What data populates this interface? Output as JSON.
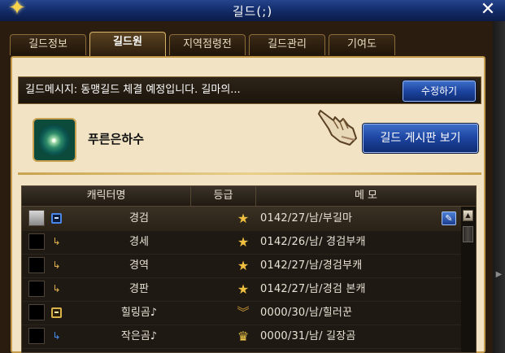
{
  "window": {
    "title": "길드(;)",
    "emblem_icon": "sparkle-emblem-icon",
    "close_label": "✕"
  },
  "tabs": [
    {
      "label": "길드정보",
      "active": false
    },
    {
      "label": "길드원",
      "active": true
    },
    {
      "label": "지역점령전",
      "active": false
    },
    {
      "label": "길드관리",
      "active": false
    },
    {
      "label": "기여도",
      "active": false
    }
  ],
  "notice": {
    "message": "길드메시지: 동맹길드 체결 예정입니다. 길마의...",
    "edit_button": "수정하기"
  },
  "guild": {
    "name": "푸른은하수",
    "board_button": "길드 게시판 보기",
    "icon": "galaxy-swirl-icon"
  },
  "table": {
    "headers": {
      "character": "캐릭터명",
      "grade": "등급",
      "memo": "메 모"
    },
    "rows": [
      {
        "name": "경검",
        "memo": "0142/27/남/부길마",
        "grade_icon": "star-icon",
        "rank_icon": "blue-box-icon",
        "selected": true,
        "has_portrait": true,
        "editable": true
      },
      {
        "name": "경세",
        "memo": "0142/26/남/ 경검부캐",
        "grade_icon": "star-icon",
        "rank_icon": "sub-arrow-icon",
        "selected": false,
        "has_portrait": false,
        "editable": false
      },
      {
        "name": "경역",
        "memo": "0142/27/남/경검부캐",
        "grade_icon": "star-icon",
        "rank_icon": "sub-arrow-icon",
        "selected": false,
        "has_portrait": false,
        "editable": false
      },
      {
        "name": "경판",
        "memo": "0142/27/남/경검 본캐",
        "grade_icon": "star-icon",
        "rank_icon": "sub-arrow-icon",
        "selected": false,
        "has_portrait": false,
        "editable": false
      },
      {
        "name": "힐링곰♪",
        "memo": "0000/30/남/힐러꾼",
        "grade_icon": "chevron-rank-icon",
        "rank_icon": "yellow-box-icon",
        "selected": false,
        "has_portrait": false,
        "editable": false
      },
      {
        "name": "작은곰♪",
        "memo": "0000/31/남/ 길장곰",
        "grade_icon": "crown-icon",
        "rank_icon": "blue-arrow-icon",
        "selected": false,
        "has_portrait": false,
        "editable": false
      }
    ]
  },
  "colors": {
    "panel_bg": "#f1e3c4",
    "button_blue": "#1c44a0",
    "frame_brown": "#2a1c0e",
    "star_gold": "#f0c040"
  }
}
